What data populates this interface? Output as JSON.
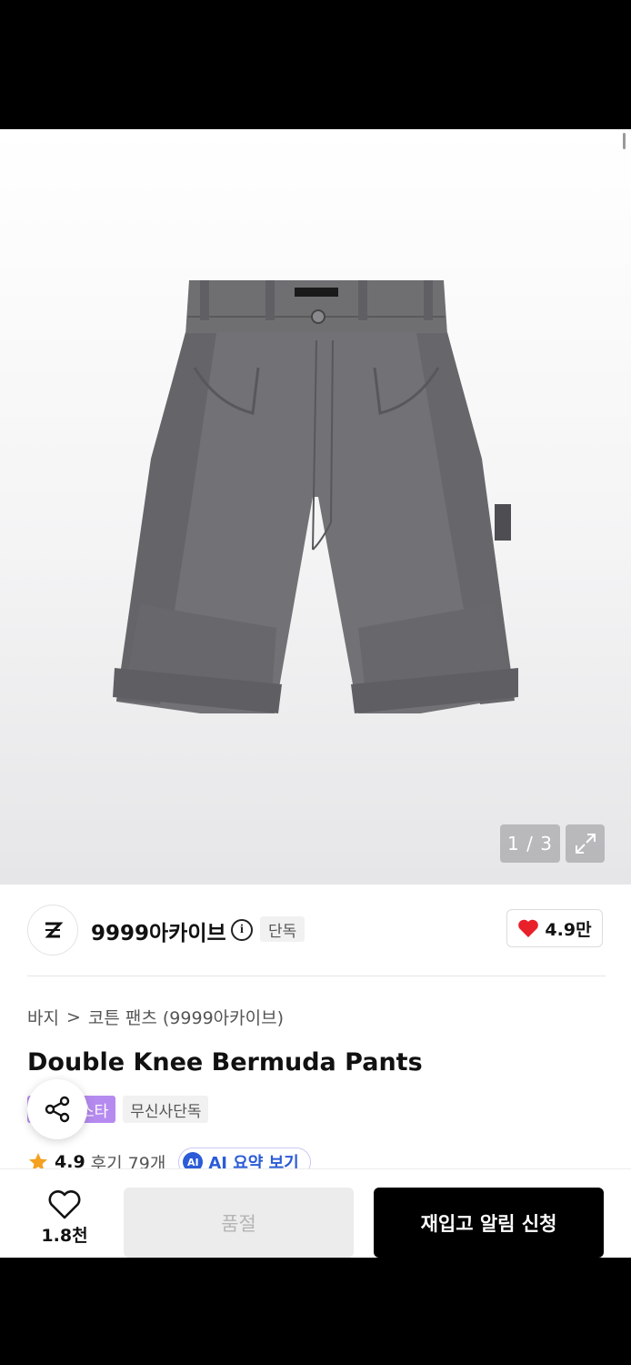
{
  "gallery": {
    "counter": "1 / 3",
    "icons": {
      "expand": "expand-icon"
    }
  },
  "brand": {
    "name": "9999아카이브",
    "exclusive_tag": "단독",
    "like_count": "4.9만",
    "icons": {
      "info": "info-icon",
      "heart": "heart-filled-icon",
      "logo": "brand-logo"
    }
  },
  "breadcrumb": {
    "category": "바지",
    "separator": ">",
    "subcategory": "코튼 팬츠 (9999아카이브)"
  },
  "product": {
    "title": "Double Knee Bermuda Pants",
    "tags": [
      "스타",
      "무신사단독"
    ],
    "rating": "4.9",
    "reviews": "후기 79개",
    "ai_badge": "AI",
    "ai_summary_label": "AI 요약 보기"
  },
  "actions": {
    "wish_count": "1.8천",
    "soldout_label": "품절",
    "restock_label": "재입고 알림 신청"
  },
  "colors": {
    "accent_purple": "#b68bf0",
    "heart_red": "#e8202a",
    "star_orange": "#f4a020",
    "ai_blue": "#2b5bd7"
  }
}
